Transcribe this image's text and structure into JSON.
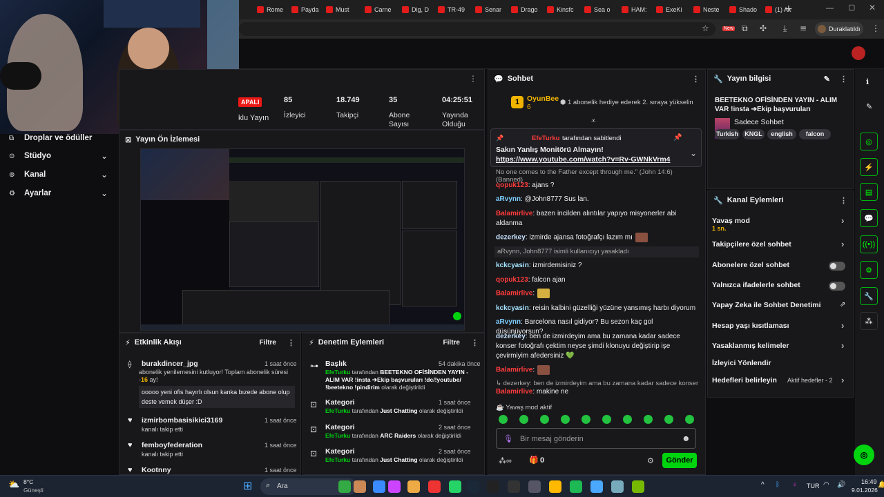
{
  "browser": {
    "tabs": [
      "Rome",
      "Payda",
      "Must",
      "Carne",
      "Dig, D",
      "TR-49",
      "Senar",
      "Drago",
      "Kinsfc",
      "Sea o",
      "HAM:",
      "ExeKi",
      "Neste",
      "Shado",
      "(1) Ak"
    ],
    "profile_label": "Duraklatıldı",
    "new_badge": "New"
  },
  "left_nav": {
    "items": [
      {
        "label": "Droplar ve ödüller",
        "icon": "drops-icon"
      },
      {
        "label": "Stüdyo",
        "icon": "studio-icon"
      },
      {
        "label": "Kanal",
        "icon": "channel-icon"
      },
      {
        "label": "Ayarlar",
        "icon": "gear-icon"
      }
    ]
  },
  "stats": {
    "live_badge": "APALI",
    "first_label": "klu Yayın",
    "items": [
      {
        "value": "85",
        "label": "İzleyici"
      },
      {
        "value": "18.749",
        "label": "Takipçi"
      },
      {
        "value": "35",
        "label": "Abone Sayısı"
      },
      {
        "value": "04:25:51",
        "label": "Yayında Olduğu"
      }
    ]
  },
  "preview": {
    "title": "Yayın Ön İzlemesi"
  },
  "activity": {
    "title": "Etkinlik Akışı",
    "filter": "Filtre",
    "events": [
      {
        "user": "burakdincer_jpg",
        "time": "1 saat önce",
        "desc": "abonelik yenilemesini kutluyor! Toplam abonelik süresi -",
        "months": "16",
        "months_suffix": " ay!",
        "message": "ooooo yeni ofis hayırlı olsun kanka bızede abone olup deste vemek düşer :D"
      },
      {
        "user": "izmirbombasisikici3169",
        "time": "1 saat önce",
        "desc": "kanalı takip etti"
      },
      {
        "user": "femboyfederation",
        "time": "1 saat önce",
        "desc": "kanalı takip etti"
      },
      {
        "user": "Kootnny",
        "time": "1 saat önce",
        "desc": ""
      }
    ]
  },
  "moderation": {
    "title": "Denetim Eylemleri",
    "filter": "Filtre",
    "items": [
      {
        "kind": "Başlık",
        "time": "54 dakika önce",
        "actor": "EfeTurku",
        "mid": " tarafından ",
        "target": "BEETEKNO OFİSİNDEN YAYIN - ALIM VAR !insta ➔Ekip başvuruları !dc/!youtube/ !beetekno !pindirim",
        "tail": " olarak değiştirildi"
      },
      {
        "kind": "Kategori",
        "time": "1 saat önce",
        "actor": "EfeTurku",
        "mid": " tarafından ",
        "target": "Just Chatting",
        "tail": " olarak değiştirildi"
      },
      {
        "kind": "Kategori",
        "time": "2 saat önce",
        "actor": "EfeTurku",
        "mid": " tarafından ",
        "target": "ARC Raiders",
        "tail": " olarak değiştirildi"
      },
      {
        "kind": "Kategori",
        "time": "2 saat önce",
        "actor": "EfeTurku",
        "mid": " tarafından ",
        "target": "Just Chatting",
        "tail": " olarak değiştirildi"
      }
    ]
  },
  "chat": {
    "title": "Sohbet",
    "top_user": "OyunBee",
    "top_rank": "1",
    "top_count": "6",
    "gift_text": "1 abonelik hediye ederek 2. sıraya yükselin",
    "pinned_by": "EfeTurku",
    "pinned_suffix": " tarafından sabitlendi",
    "pinned_msg": "Sakın Yanlış Monitörü Almayın!",
    "pinned_link": "https://www.youtube.com/watch?v=Rv-GWNkVrm4",
    "banned_line": "No one comes to the Father except through me.\" (John 14:6)",
    "banned_tag": "(Banned)",
    "messages": [
      {
        "user": "qopuk123",
        "color": "#ff3b3b",
        "text": ": ajans ?"
      },
      {
        "user": "aRvynn",
        "color": "#7fd0ff",
        "text": ": @John8777 Sus lan."
      },
      {
        "user": "Balamirlive",
        "color": "#ff3b3b",
        "text": ": bazen incilden alıntılar yapıyo misyonerler abi aldanma"
      },
      {
        "user": "dezerkey",
        "color": "#c8e3ff",
        "text": ": izmirde ajansa fotoğrafçı lazım mı"
      },
      {
        "user": "kckcyasin",
        "color": "#a6e3ff",
        "text": ": izmirdemisiniz ?"
      },
      {
        "user": "qopuk123",
        "color": "#ff3b3b",
        "text": ": falcon ajan"
      },
      {
        "user": "Balamirlive",
        "color": "#ff3b3b",
        "text": ":"
      },
      {
        "user": "kckcyasin",
        "color": "#a6e3ff",
        "text": ": reisin kalbini güzelliği yüzüne yansımış harbı diyorum"
      },
      {
        "user": "aRvynn",
        "color": "#7fd0ff",
        "text": ": Barcelona nasıl gidiyor? Bu sezon kaç gol düşünüyorsun?"
      },
      {
        "user": "dezerkey",
        "color": "#c8e3ff",
        "text": ": ben de izmirdeyim ama bu zamana kadar sadece konser fotoğrafı çektim neyse şimdi klonuyu değiştirip işe çevirmiyim afedersiniz 💚"
      },
      {
        "user": "Balamirlive",
        "color": "#ff3b3b",
        "text": ":"
      },
      {
        "user": "Balamirlive",
        "color": "#ff3b3b",
        "text": ": makine ne"
      }
    ],
    "system_ban": "aRvynn, John8777 isimli kullanıcıyı yasakladı",
    "reply_hint": "dezerkey: ben de izmirdeyim ama bu zamana kadar sadece konser fot...",
    "slow_mode": "Yavaş mod aktif",
    "input_placeholder": "Bir mesaj gönderin",
    "points": "0",
    "send": "Gönder"
  },
  "stream_info": {
    "title": "Yayın bilgisi",
    "stream_title": "BEETEKNO OFİSİNDEN YAYIN - ALIM VAR !insta ➔Ekip başvuruları !dc/!youtube/...",
    "category": "Sadece Sohbet",
    "tags": [
      "Turkish",
      "KNGL",
      "english",
      "falcon"
    ]
  },
  "channel_actions": {
    "title": "Kanal Eylemleri",
    "rows": [
      {
        "label": "Yavaş mod",
        "sub": "1 sn.",
        "control": "chevron"
      },
      {
        "label": "Takipçilere özel sohbet",
        "control": "chevron"
      },
      {
        "label": "Abonelere özel sohbet",
        "control": "toggle"
      },
      {
        "label": "Yalnızca ifadelerle sohbet",
        "control": "toggle"
      },
      {
        "label": "Yapay Zeka ile Sohbet Denetimi",
        "control": "external"
      },
      {
        "label": "Hesap yaşı kısıtlaması",
        "control": "chevron"
      },
      {
        "label": "Yasaklanmış kelimeler",
        "control": "chevron"
      },
      {
        "label": "İzleyici Yönlendir",
        "control": "none"
      },
      {
        "label": "Hedefleri belirleyin",
        "control": "chevron",
        "extra": "Aktif hedefler - 2"
      }
    ]
  },
  "taskbar": {
    "weather_temp": "8°C",
    "weather_desc": "Güneşli",
    "search": "Ara",
    "lang": "TUR",
    "time": "16:49",
    "date": "9.01.2026"
  },
  "colors": {
    "accent": "#00d40f",
    "panel": "#18181b",
    "bg": "#0e0e10"
  }
}
